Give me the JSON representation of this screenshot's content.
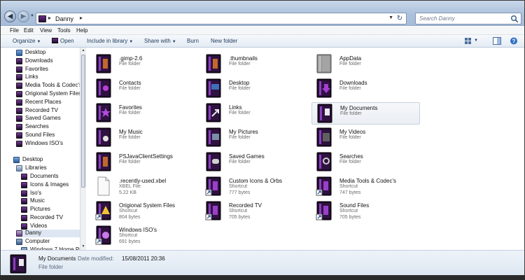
{
  "address": {
    "crumb": "Danny"
  },
  "search": {
    "placeholder": "Search Danny"
  },
  "menu": [
    "File",
    "Edit",
    "View",
    "Tools",
    "Help"
  ],
  "toolbar": {
    "organize": "Organize",
    "open": "Open",
    "include": "Include in library",
    "share": "Share with",
    "burn": "Burn",
    "new_folder": "New folder"
  },
  "nav": {
    "favorites": [
      {
        "label": "Desktop",
        "icon": "desktop-icon"
      },
      {
        "label": "Downloads",
        "icon": "folder-icon"
      },
      {
        "label": "Favorites",
        "icon": "folder-icon"
      },
      {
        "label": "Links",
        "icon": "folder-icon"
      },
      {
        "label": "Media Tools & Codec's",
        "icon": "folder-icon"
      },
      {
        "label": "Origional System Files",
        "icon": "folder-icon"
      },
      {
        "label": "Recent Places",
        "icon": "folder-icon"
      },
      {
        "label": "Recorded TV",
        "icon": "folder-icon"
      },
      {
        "label": "Saved Games",
        "icon": "folder-icon"
      },
      {
        "label": "Searches",
        "icon": "folder-icon"
      },
      {
        "label": "Sound Files",
        "icon": "folder-icon"
      },
      {
        "label": "Windows ISO's",
        "icon": "folder-icon"
      }
    ],
    "desktop": "Desktop",
    "libraries": "Libraries",
    "library_items": [
      "Documents",
      "Icons & Images",
      "Iso's",
      "Music",
      "Pictures",
      "Recorded TV",
      "Videos"
    ],
    "user": "Danny",
    "computer": "Computer",
    "drive": "Windows 7 Home Pr..."
  },
  "items": [
    {
      "name": ".gimp-2.6",
      "type": "File folder",
      "size": "",
      "icon": "folder-icon"
    },
    {
      "name": ".thumbnails",
      "type": "File folder",
      "size": "",
      "icon": "folder-icon"
    },
    {
      "name": "AppData",
      "type": "File folder",
      "size": "",
      "icon": "hidden-folder-icon"
    },
    {
      "name": "Contacts",
      "type": "File folder",
      "size": "",
      "icon": "contacts-folder-icon"
    },
    {
      "name": "Desktop",
      "type": "File folder",
      "size": "",
      "icon": "desktop-folder-icon"
    },
    {
      "name": "Downloads",
      "type": "File folder",
      "size": "",
      "icon": "downloads-folder-icon"
    },
    {
      "name": "Favorites",
      "type": "File folder",
      "size": "",
      "icon": "favorites-folder-icon"
    },
    {
      "name": "Links",
      "type": "File folder",
      "size": "",
      "icon": "links-folder-icon"
    },
    {
      "name": "My Documents",
      "type": "File folder",
      "size": "",
      "icon": "documents-folder-icon",
      "selected": true
    },
    {
      "name": "My Music",
      "type": "File folder",
      "size": "",
      "icon": "music-folder-icon"
    },
    {
      "name": "My Pictures",
      "type": "File folder",
      "size": "",
      "icon": "pictures-folder-icon"
    },
    {
      "name": "My Videos",
      "type": "File folder",
      "size": "",
      "icon": "videos-folder-icon"
    },
    {
      "name": "PSJavaClientSettings",
      "type": "File folder",
      "size": "",
      "icon": "folder-icon"
    },
    {
      "name": "Saved Games",
      "type": "File folder",
      "size": "",
      "icon": "games-folder-icon"
    },
    {
      "name": "Searches",
      "type": "File folder",
      "size": "",
      "icon": "searches-folder-icon"
    },
    {
      "name": ".recently-used.xbel",
      "type": "XBEL File",
      "size": "5.22 KB",
      "icon": "file-icon"
    },
    {
      "name": "Custom Icons & Orbs",
      "type": "Shortcut",
      "size": "777 bytes",
      "icon": "shortcut-folder-icon"
    },
    {
      "name": "Media Tools & Codec's",
      "type": "Shortcut",
      "size": "747 bytes",
      "icon": "shortcut-folder-icon"
    },
    {
      "name": "Origional System Files",
      "type": "Shortcut",
      "size": "804 bytes",
      "icon": "shortcut-warning-icon"
    },
    {
      "name": "Recorded TV",
      "type": "Shortcut",
      "size": "705 bytes",
      "icon": "shortcut-folder-icon"
    },
    {
      "name": "Sound Files",
      "type": "Shortcut",
      "size": "705 bytes",
      "icon": "shortcut-folder-icon"
    },
    {
      "name": "Windows ISO's",
      "type": "Shortcut",
      "size": "691 bytes",
      "icon": "shortcut-disc-icon"
    }
  ],
  "details": {
    "name": "My Documents",
    "modified_label": "Date modified:",
    "modified_value": "15/08/2011 20:36",
    "type": "File folder"
  },
  "colors": {
    "folder_dark": "#1e0a2b",
    "folder_accent": "#8a3fc0",
    "selection": "#dde6f2"
  }
}
